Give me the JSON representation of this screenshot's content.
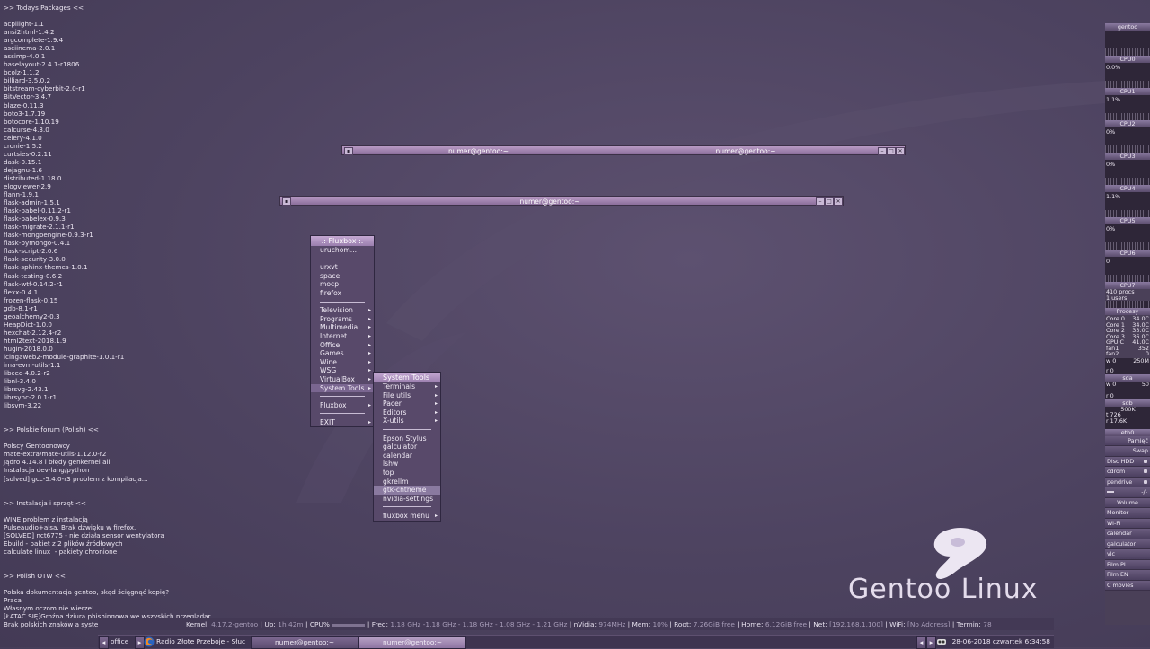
{
  "conky": {
    "sections": [
      {
        "header": ">> Todays Packages <<",
        "items": [
          "acpilight-1.1",
          "ansi2html-1.4.2",
          "argcomplete-1.9.4",
          "asciinema-2.0.1",
          "assimp-4.0.1",
          "baselayout-2.4.1-r1806",
          "bcolz-1.1.2",
          "billiard-3.5.0.2",
          "bitstream-cyberbit-2.0-r1",
          "BitVector-3.4.7",
          "blaze-0.11.3",
          "boto3-1.7.19",
          "botocore-1.10.19",
          "calcurse-4.3.0",
          "celery-4.1.0",
          "cronie-1.5.2",
          "curtsies-0.2.11",
          "dask-0.15.1",
          "dejagnu-1.6",
          "distributed-1.18.0",
          "elogviewer-2.9",
          "flann-1.9.1",
          "flask-admin-1.5.1",
          "flask-babel-0.11.2-r1",
          "flask-babelex-0.9.3",
          "flask-migrate-2.1.1-r1",
          "flask-mongoengine-0.9.3-r1",
          "flask-pymongo-0.4.1",
          "flask-script-2.0.6",
          "flask-security-3.0.0",
          "flask-sphinx-themes-1.0.1",
          "flask-testing-0.6.2",
          "flask-wtf-0.14.2-r1",
          "flexx-0.4.1",
          "frozen-flask-0.15",
          "gdb-8.1-r1",
          "geoalchemy2-0.3",
          "HeapDict-1.0.0",
          "hexchat-2.12.4-r2",
          "html2text-2018.1.9",
          "hugin-2018.0.0",
          "icingaweb2-module-graphite-1.0.1-r1",
          "ima-evm-utils-1.1",
          "libcec-4.0.2-r2",
          "libnl-3.4.0",
          "librsvg-2.43.1",
          "librsync-2.0.1-r1",
          "libsvm-3.22"
        ]
      },
      {
        "header": ">> Polskie forum (Polish) <<",
        "items": [
          "Polscy Gentoonowcy",
          "mate-extra/mate-utils-1.12.0-r2",
          "Jądro 4.14.8 i błędy genkernel all",
          "Instalacja dev-lang/python",
          "[solved] gcc-5.4.0-r3 problem z kompilacja..."
        ]
      },
      {
        "header": ">> Instalacja i sprzęt <<",
        "items": [
          "WINE problem z instalacją",
          "Pulseaudio+alsa. Brak dźwięku w firefox.",
          "[SOLVED] nct6775 - nie działa sensor wentylatora",
          "Ebuild - pakiet z 2 plików źródłowych",
          "calculate linux  - pakiety chronione"
        ]
      },
      {
        "header": ">> Polish OTW <<",
        "items": [
          "Polska dokumentacja gentoo, skąd ściągnąć kopię?",
          "Praca",
          "Własnym oczom nie wierze!",
          "[ŁATAĆ SIĘ]Groźna dziura phishingowa we wszyskich przeglądar",
          "Brak polskich znaków a system spolszczony w całości"
        ]
      }
    ]
  },
  "windows": {
    "win1": {
      "title_left": "numer@gentoo:~",
      "title_right": "numer@gentoo:~"
    },
    "win2": {
      "title": "numer@gentoo:~"
    },
    "buttons": {
      "minimize": "–",
      "maximize": "□",
      "close": "✕",
      "menu": "▪"
    }
  },
  "fluxbox_menu": {
    "title": ".: Fluxbox :.",
    "items": [
      {
        "label": "uruchom...",
        "sub": false
      },
      {
        "sep": true
      },
      {
        "label": "urxvt",
        "sub": false
      },
      {
        "label": "space",
        "sub": false
      },
      {
        "label": "mocp",
        "sub": false
      },
      {
        "label": "firefox",
        "sub": false
      },
      {
        "sep": true
      },
      {
        "label": "Television",
        "sub": true
      },
      {
        "label": "Programs",
        "sub": true
      },
      {
        "label": "Multimedia",
        "sub": true
      },
      {
        "label": "Internet",
        "sub": true
      },
      {
        "label": "Office",
        "sub": true
      },
      {
        "label": "Games",
        "sub": true
      },
      {
        "label": "Wine",
        "sub": true
      },
      {
        "label": "WSG",
        "sub": true
      },
      {
        "label": "VirtualBox",
        "sub": true
      },
      {
        "label": "System Tools",
        "sub": true,
        "active": true
      },
      {
        "sep": true
      },
      {
        "label": "Fluxbox",
        "sub": true
      },
      {
        "sep": true
      },
      {
        "label": "EXIT",
        "sub": true
      }
    ]
  },
  "system_tools_menu": {
    "title": "System Tools",
    "items": [
      {
        "label": "Terminals",
        "sub": true
      },
      {
        "label": "File utils",
        "sub": true
      },
      {
        "label": "Pacer",
        "sub": true
      },
      {
        "label": "Editors",
        "sub": true
      },
      {
        "label": "X-utils",
        "sub": true
      },
      {
        "sep": true
      },
      {
        "label": "Epson Stylus",
        "sub": false
      },
      {
        "label": "galculator",
        "sub": false
      },
      {
        "label": "calendar",
        "sub": false
      },
      {
        "label": "lshw",
        "sub": false
      },
      {
        "label": "top",
        "sub": false
      },
      {
        "label": "gkrellm",
        "sub": false
      },
      {
        "label": "gtk-chtheme",
        "sub": false,
        "active": true
      },
      {
        "label": "nvidia-settings",
        "sub": false
      },
      {
        "sep": true
      },
      {
        "label": "fluxbox menu",
        "sub": true
      }
    ]
  },
  "gkrellm": {
    "host": "gentoo",
    "cpus": [
      {
        "label": "CPU0",
        "value": ""
      },
      {
        "label": "CPU1",
        "value": "0.0%"
      },
      {
        "label": "CPU2",
        "value": "1.1%"
      },
      {
        "label": "CPU3",
        "value": "0%"
      },
      {
        "label": "CPU4",
        "value": "0%"
      },
      {
        "label": "CPU5",
        "value": "1.1%"
      },
      {
        "label": "CPU6",
        "value": "0%"
      },
      {
        "label": "CPU7",
        "value": "0"
      }
    ],
    "procs": "410 procs",
    "users": "1 users",
    "procesy_label": "Procesy",
    "sensors": [
      {
        "name": "Core 0",
        "value": "34.0C"
      },
      {
        "name": "Core 1",
        "value": "34.0C"
      },
      {
        "name": "Core 2",
        "value": "33.0C"
      },
      {
        "name": "Core 3",
        "value": "36.0C"
      },
      {
        "name": "GPU C",
        "value": "41.0C"
      },
      {
        "name": "fan1",
        "value": "352"
      },
      {
        "name": "fan2",
        "value": "0"
      }
    ],
    "disk_sda": {
      "label": "sda",
      "w": "w 0",
      "r": "r 0",
      "total": "250M"
    },
    "disk_sdb": {
      "label": "sdb",
      "w": "w 0",
      "r": "r 0",
      "total": "50"
    },
    "net": {
      "label": "eth0",
      "rx": "500K",
      "t": "t 726",
      "r": "r 17.6K"
    },
    "pamiec_label": "Pamięć",
    "swap_label": "Swap",
    "mounts": [
      "Disc HDD",
      "cdrom",
      "pendrive"
    ],
    "volume_value": "-/-",
    "volume_label": "Volume",
    "launchers": [
      "Monitor",
      "Wi-Fi",
      "calendar",
      "galculator",
      "vlc",
      "Film PL",
      "Film EN",
      "C movies"
    ]
  },
  "statusbar": {
    "kernel_label": "Kernel:",
    "kernel": "4.17.2-gentoo",
    "up_label": "Up:",
    "up": "1h 42m",
    "cpu_label": "CPU%",
    "freq_label": "Freq:",
    "freq": "1,18 GHz -1,18 GHz - 1,18 GHz - 1,08 GHz - 1,21 GHz",
    "nvidia_label": "nVidia:",
    "nvidia": "974MHz",
    "mem_label": "Mem:",
    "mem": "10%",
    "root_label": "Root:",
    "root": "7,26GiB free",
    "home_label": "Home:",
    "home": "6,12GiB free",
    "net_label": "Net:",
    "net": "[192.168.1.100]",
    "wifi_label": "WiFi:",
    "wifi": "[No Address]",
    "termin_label": "Termin:",
    "termin": "78"
  },
  "taskbar": {
    "workspace": "office",
    "tasks": [
      {
        "label": "Radio Złote Przeboje - Słuc",
        "active": false
      },
      {
        "label": "numer@gentoo:~",
        "active": false
      },
      {
        "label": "numer@gentoo:~",
        "active": true
      }
    ],
    "clock": "28-06-2018 czwartek  6:34:58"
  },
  "logo": {
    "text": "Gentoo Linux"
  }
}
